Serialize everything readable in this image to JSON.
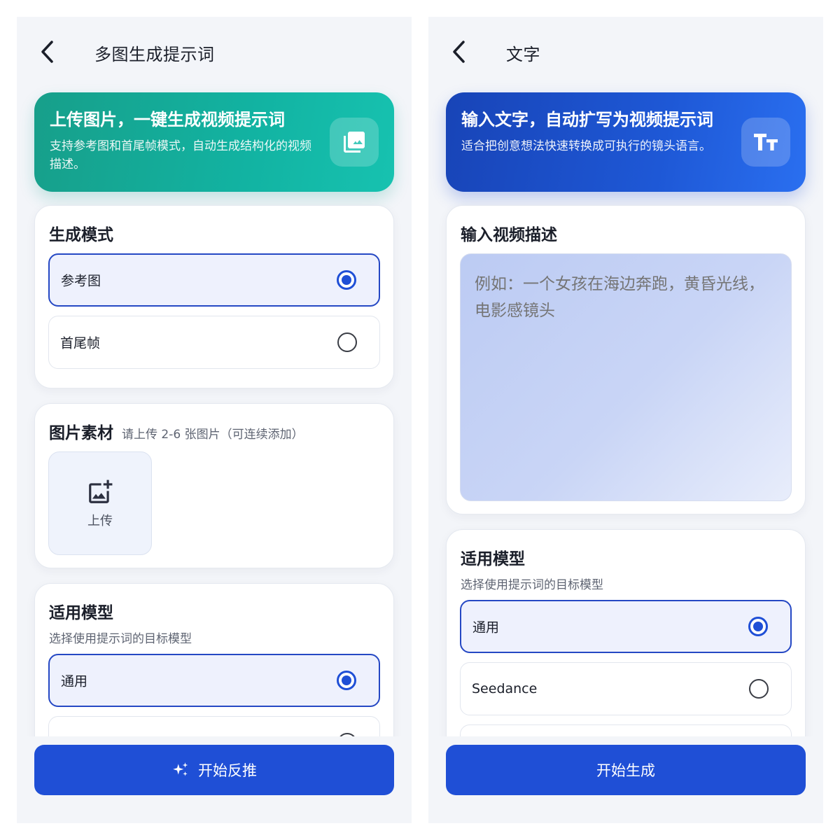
{
  "left": {
    "header": {
      "title": "多图生成提示词"
    },
    "hero": {
      "title": "上传图片，一键生成视频提示词",
      "desc": "支持参考图和首尾帧模式，自动生成结构化的视频描述。",
      "icon": "photo-library-icon"
    },
    "mode_card": {
      "title": "生成模式",
      "options": [
        {
          "label": "参考图",
          "selected": true
        },
        {
          "label": "首尾帧",
          "selected": false
        }
      ]
    },
    "image_card": {
      "title": "图片素材",
      "hint": "请上传 2-6 张图片（可连续添加）",
      "upload_label": "上传",
      "upload_icon": "add-photo-icon"
    },
    "model_card": {
      "title": "适用模型",
      "subtitle": "选择使用提示词的目标模型",
      "options": [
        {
          "label": "通用",
          "selected": true
        },
        {
          "label": "",
          "selected": false
        }
      ]
    },
    "cta": {
      "label": "开始反推",
      "icon": "sparkle-icon"
    }
  },
  "right": {
    "header": {
      "title": "文字"
    },
    "hero": {
      "title": "输入文字，自动扩写为视频提示词",
      "desc": "适合把创意想法快速转换成可执行的镜头语言。",
      "icon": "text-size-icon"
    },
    "input_card": {
      "title": "输入视频描述",
      "placeholder": "例如：一个女孩在海边奔跑，黄昏光线，电影感镜头"
    },
    "model_card": {
      "title": "适用模型",
      "subtitle": "选择使用提示词的目标模型",
      "options": [
        {
          "label": "通用",
          "selected": true
        },
        {
          "label": "Seedance",
          "selected": false
        },
        {
          "label": "",
          "selected": false
        }
      ]
    },
    "cta": {
      "label": "开始生成"
    }
  },
  "colors": {
    "primary": "#1f4fd6",
    "teal": "#12b3a2",
    "background": "#f3f5f9"
  }
}
